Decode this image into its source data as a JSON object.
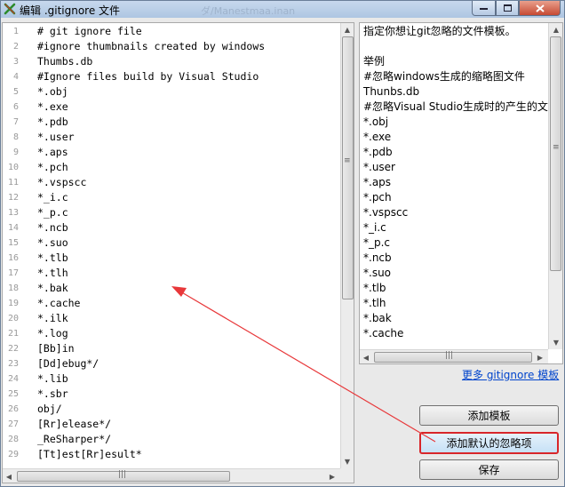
{
  "window": {
    "title": "编辑 .gitignore 文件",
    "background_title": "ダ/Manestmaa.inan",
    "minimize_icon": "minimize-icon",
    "maximize_icon": "maximize-icon",
    "close_icon": "close-icon"
  },
  "editor": {
    "lines": [
      {
        "n": "1",
        "text": "# git ignore file"
      },
      {
        "n": "2",
        "text": "#ignore thumbnails created by windows"
      },
      {
        "n": "3",
        "text": "Thumbs.db"
      },
      {
        "n": "4",
        "text": "#Ignore files build by Visual Studio"
      },
      {
        "n": "5",
        "text": "*.obj"
      },
      {
        "n": "6",
        "text": "*.exe"
      },
      {
        "n": "7",
        "text": "*.pdb"
      },
      {
        "n": "8",
        "text": "*.user"
      },
      {
        "n": "9",
        "text": "*.aps"
      },
      {
        "n": "10",
        "text": "*.pch"
      },
      {
        "n": "11",
        "text": "*.vspscc"
      },
      {
        "n": "12",
        "text": "*_i.c"
      },
      {
        "n": "13",
        "text": "*_p.c"
      },
      {
        "n": "14",
        "text": "*.ncb"
      },
      {
        "n": "15",
        "text": "*.suo"
      },
      {
        "n": "16",
        "text": "*.tlb"
      },
      {
        "n": "17",
        "text": "*.tlh"
      },
      {
        "n": "18",
        "text": "*.bak"
      },
      {
        "n": "19",
        "text": "*.cache"
      },
      {
        "n": "20",
        "text": "*.ilk"
      },
      {
        "n": "21",
        "text": "*.log"
      },
      {
        "n": "22",
        "text": "[Bb]in"
      },
      {
        "n": "23",
        "text": "[Dd]ebug*/"
      },
      {
        "n": "24",
        "text": "*.lib"
      },
      {
        "n": "25",
        "text": "*.sbr"
      },
      {
        "n": "26",
        "text": "obj/"
      },
      {
        "n": "27",
        "text": "[Rr]elease*/"
      },
      {
        "n": "28",
        "text": "_ReSharper*/"
      },
      {
        "n": "29",
        "text": "[Tt]est[Rr]esult*"
      }
    ]
  },
  "help": {
    "lines": [
      "指定你想让git忽略的文件模板。",
      "",
      "举例",
      "#忽略windows生成的缩略图文件",
      "Thunbs.db",
      "#忽略Visual Studio生成时的产生的文",
      "*.obj",
      "*.exe",
      "*.pdb",
      "*.user",
      "*.aps",
      "*.pch",
      "*.vspscc",
      "*_i.c",
      "*_p.c",
      "*.ncb",
      "*.suo",
      "*.tlb",
      "*.tlh",
      "*.bak",
      "*.cache"
    ]
  },
  "more_link": "更多 gitignore 模板",
  "buttons": {
    "add_template": "添加模板",
    "add_default": "添加默认的忽略项",
    "save": "保存"
  },
  "colors": {
    "annotation_arrow": "#e8383a",
    "link": "#0044cc"
  }
}
